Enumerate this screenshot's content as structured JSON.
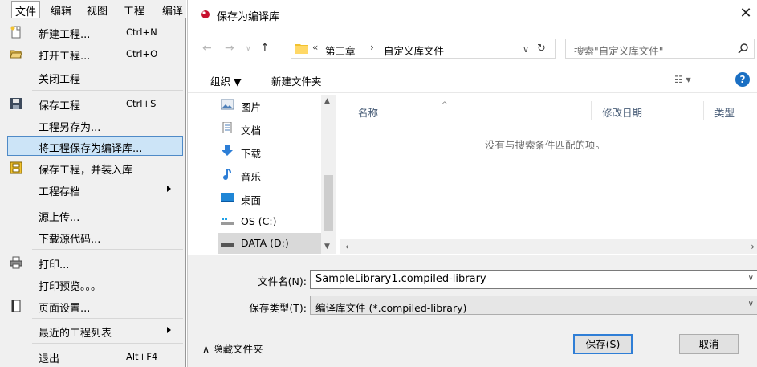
{
  "menubar": {
    "items": [
      "文件",
      "编辑",
      "视图",
      "工程",
      "编译"
    ]
  },
  "file_menu": {
    "items": [
      {
        "label": "新建工程...",
        "shortcut": "Ctrl+N",
        "icon": "new-project-icon"
      },
      {
        "label": "打开工程...",
        "shortcut": "Ctrl+O",
        "icon": "open-folder-icon"
      },
      {
        "label": "关闭工程",
        "shortcut": "",
        "icon": ""
      },
      {
        "label": "保存工程",
        "shortcut": "Ctrl+S",
        "icon": "save-disk-icon"
      },
      {
        "label": "工程另存为...",
        "shortcut": "",
        "icon": ""
      },
      {
        "label": "将工程保存为编译库...",
        "shortcut": "",
        "icon": "",
        "highlighted": true
      },
      {
        "label": "保存工程，并装入库",
        "shortcut": "",
        "icon": "save-install-icon"
      },
      {
        "label": "工程存档",
        "shortcut": "",
        "icon": "",
        "submenu": true
      },
      {
        "label": "源上传...",
        "shortcut": "",
        "icon": ""
      },
      {
        "label": "下载源代码...",
        "shortcut": "",
        "icon": ""
      },
      {
        "label": "打印...",
        "shortcut": "",
        "icon": "printer-icon"
      },
      {
        "label": "打印预览。。。",
        "shortcut": "",
        "icon": ""
      },
      {
        "label": "页面设置...",
        "shortcut": "",
        "icon": "page-setup-icon"
      },
      {
        "label": "最近的工程列表",
        "shortcut": "",
        "icon": "",
        "submenu": true
      },
      {
        "label": "退出",
        "shortcut": "Alt+F4",
        "icon": ""
      }
    ]
  },
  "dialog": {
    "title": "保存为编译库",
    "close_glyph": "✕",
    "address": {
      "prefix": "«",
      "crumbs": [
        "第三章",
        "自定义库文件"
      ],
      "separator": "›"
    },
    "search_placeholder": "搜索\"自定义库文件\"",
    "toolbar": {
      "organize": "组织 ▼",
      "new_folder": "新建文件夹",
      "help": "?"
    },
    "nav_items": [
      {
        "label": "图片",
        "icon": "pictures-icon"
      },
      {
        "label": "文档",
        "icon": "documents-icon"
      },
      {
        "label": "下载",
        "icon": "downloads-icon"
      },
      {
        "label": "音乐",
        "icon": "music-icon"
      },
      {
        "label": "桌面",
        "icon": "desktop-icon"
      },
      {
        "label": "OS (C:)",
        "icon": "drive-c-icon"
      },
      {
        "label": "DATA (D:)",
        "icon": "drive-d-icon",
        "selected": true
      }
    ],
    "columns": [
      "名称",
      "修改日期",
      "类型"
    ],
    "empty_message": "没有与搜索条件匹配的项。",
    "file_name_label": "文件名(N):",
    "file_name_value": "SampleLibrary1.compiled-library",
    "save_type_label": "保存类型(T):",
    "save_type_value": "编译库文件 (*.compiled-library)",
    "hide_folders": "∧  隐藏文件夹",
    "save_button": "保存(S)",
    "cancel_button": "取消"
  }
}
